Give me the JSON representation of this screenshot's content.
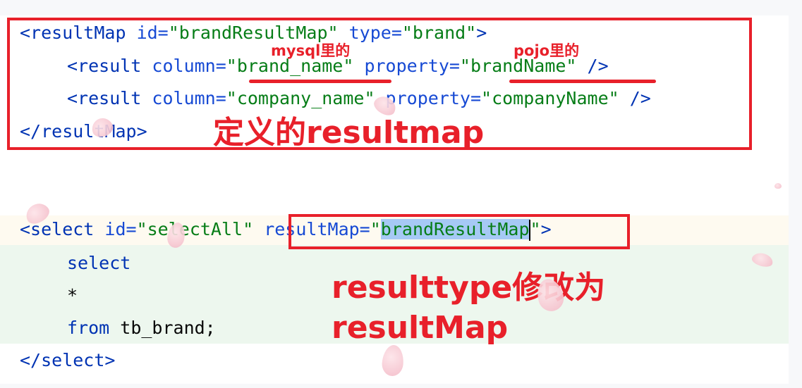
{
  "code": {
    "resultmap_open": {
      "tag": "<resultMap",
      "id_attr": " id=",
      "id_val": "\"brandResultMap\"",
      "type_attr": " type=",
      "type_val": "\"brand\"",
      "close": ">"
    },
    "result1": {
      "tag": "<result",
      "col_attr": " column=",
      "col_val": "\"brand_name\"",
      "prop_attr": " property=",
      "prop_val": "\"brandName\"",
      "close": " />"
    },
    "result2": {
      "tag": "<result",
      "col_attr": " column=",
      "col_val": "\"company_name\"",
      "prop_attr": " property=",
      "prop_val": "\"companyName\"",
      "close": " />"
    },
    "resultmap_close": "</resultMap>",
    "select_open": {
      "tag": "<select",
      "id_attr": " id=",
      "id_val": "\"selectAll\"",
      "rm_attr": " resultMap=",
      "rm_q1": "\"",
      "rm_val": "brandResultMap",
      "rm_q2": "\"",
      "close": ">"
    },
    "body1": "select",
    "body2": "*",
    "body3_kw": "from",
    "body3_rest": " tb_brand;",
    "select_close": "</select>"
  },
  "annotations": {
    "mysql_note": "mysql里的",
    "pojo_note": "pojo里的",
    "define_note": "定义的resultmap",
    "change_note_1": "resulttype修改为",
    "change_note_2": "resultMap"
  },
  "colors": {
    "annotation": "#e8202a",
    "tag": "#0033b3",
    "string": "#067d17",
    "selection": "#a6c9f5"
  }
}
